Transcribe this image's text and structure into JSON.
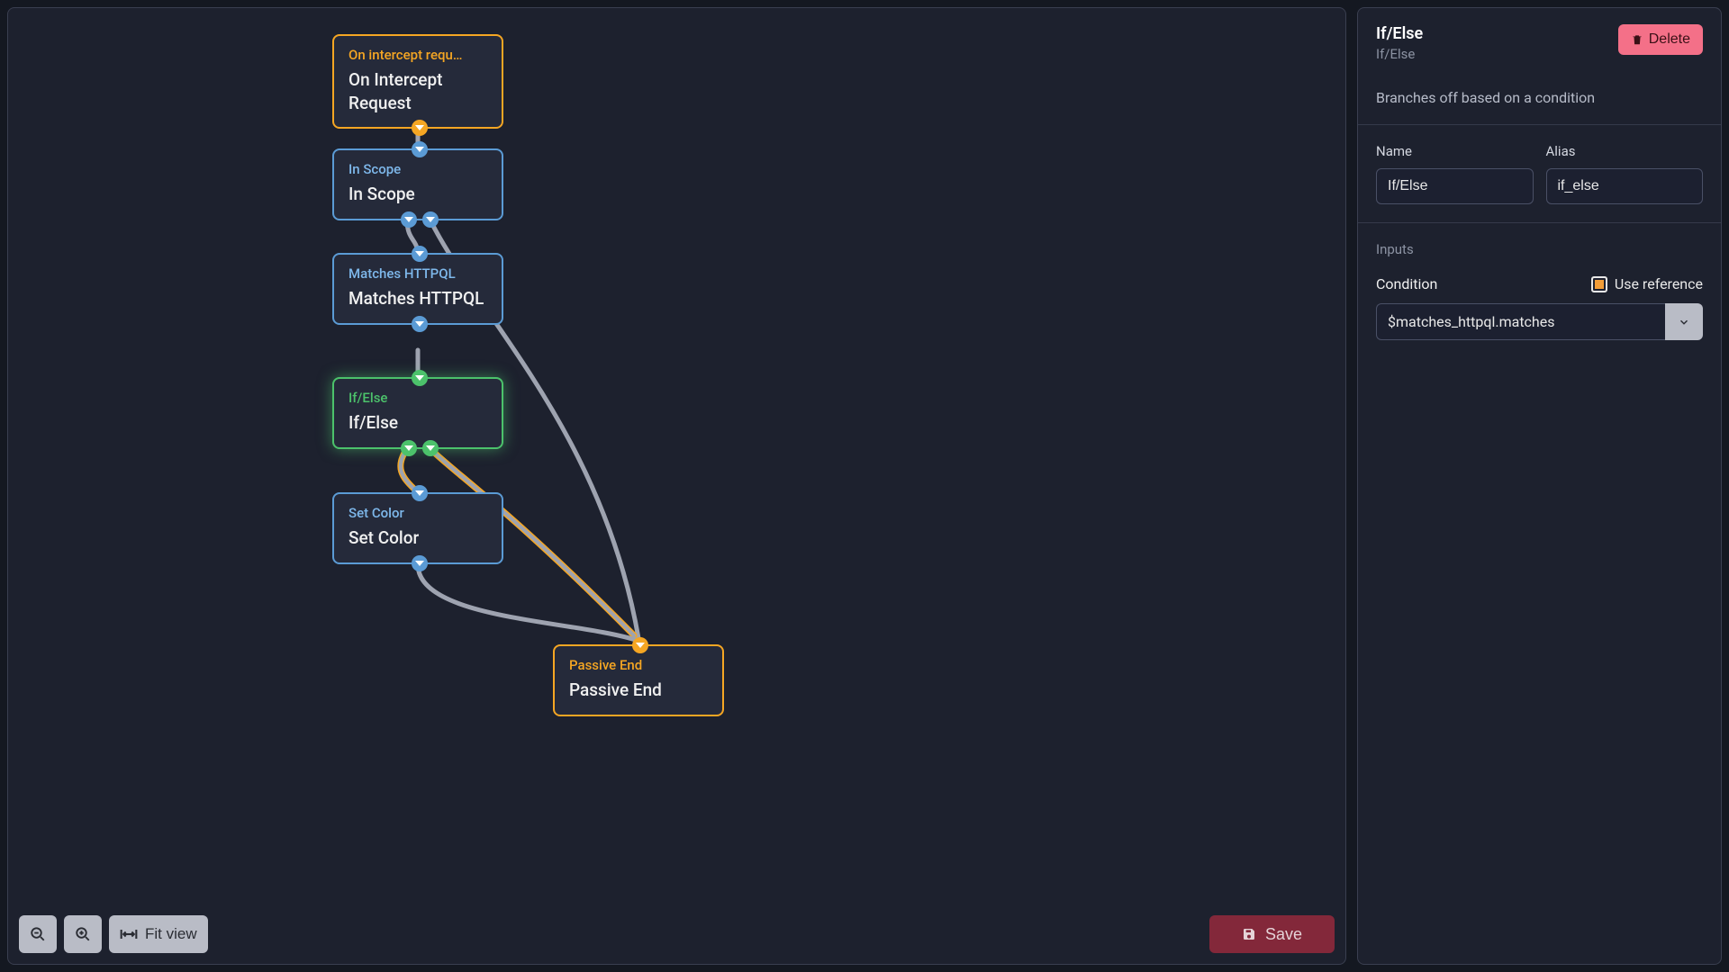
{
  "sidebar": {
    "title": "If/Else",
    "subtitle": "If/Else",
    "delete_label": "Delete",
    "description": "Branches off based on a condition",
    "name_label": "Name",
    "name_value": "If/Else",
    "alias_label": "Alias",
    "alias_value": "if_else",
    "inputs_label": "Inputs",
    "condition_label": "Condition",
    "use_reference_label": "Use reference",
    "condition_value": "$matches_httpql.matches"
  },
  "toolbar": {
    "fit_view_label": "Fit view",
    "save_label": "Save"
  },
  "nodes": {
    "n1": {
      "title": "On intercept requ…",
      "value": "On Intercept Request"
    },
    "n2": {
      "title": "In Scope",
      "value": "In Scope"
    },
    "n3": {
      "title": "Matches HTTPQL",
      "value": "Matches HTTPQL"
    },
    "n4": {
      "title": "If/Else",
      "value": "If/Else"
    },
    "n5": {
      "title": "Set Color",
      "value": "Set Color"
    },
    "n6": {
      "title": "Passive End",
      "value": "Passive End"
    }
  }
}
